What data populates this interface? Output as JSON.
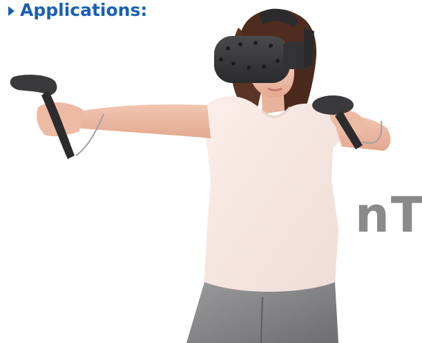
{
  "heading": {
    "text": "Applications:",
    "icon": "caret-right-icon",
    "color": "#1a5fb4"
  },
  "photo": {
    "subject": "woman wearing a VR headset holding two motion controllers",
    "watermark_text": "nT"
  }
}
